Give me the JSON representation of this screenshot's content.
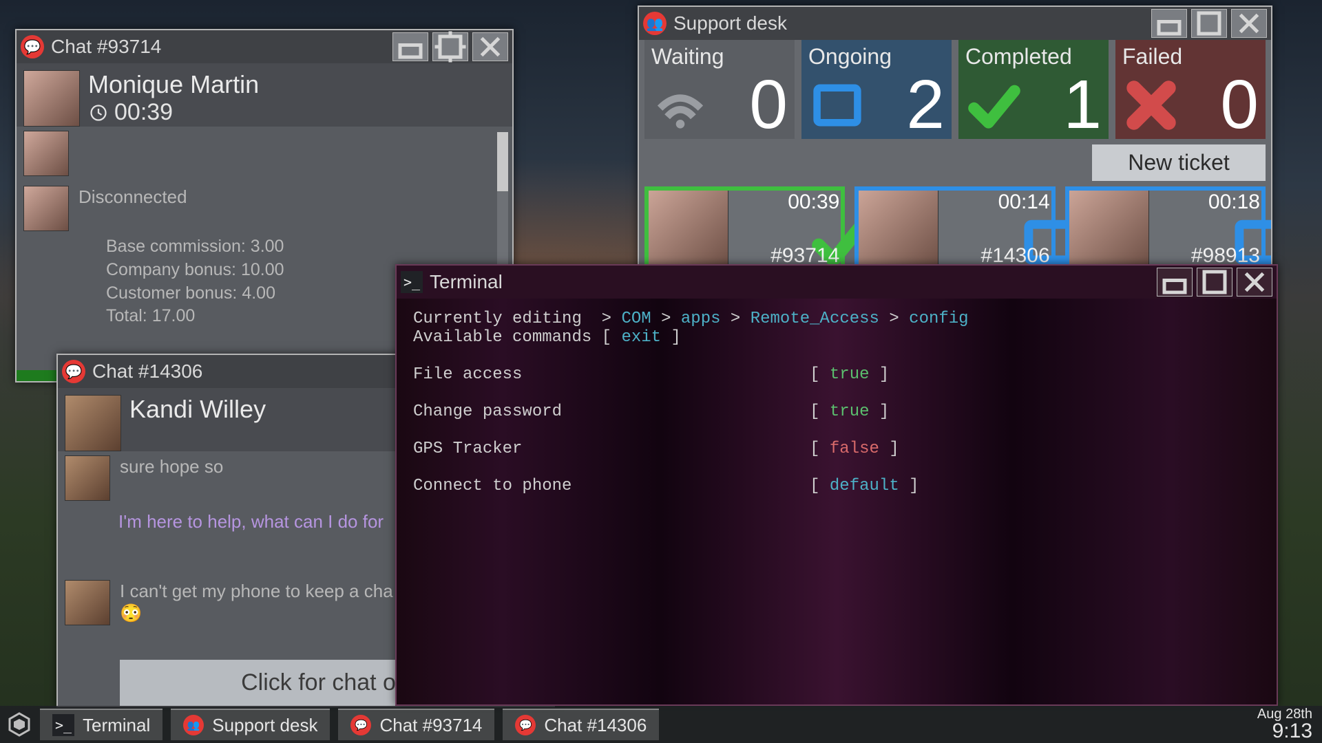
{
  "taskbar": {
    "items": [
      {
        "label": "Terminal",
        "icon": "terminal"
      },
      {
        "label": "Support desk",
        "icon": "support"
      },
      {
        "label": "Chat #93714",
        "icon": "chat"
      },
      {
        "label": "Chat #14306",
        "icon": "chat"
      }
    ],
    "date": "Aug 28th",
    "time": "9:13"
  },
  "chat1": {
    "title": "Chat #93714",
    "name": "Monique Martin",
    "timer": "00:39",
    "disconnected": "Disconnected",
    "commission": {
      "base": "Base commission: 3.00",
      "company": "Company bonus: 10.00",
      "customer": "Customer bonus: 4.00",
      "total": "Total: 17.00"
    }
  },
  "chat2": {
    "title": "Chat #14306",
    "name": "Kandi Willey",
    "lines": {
      "l1": "sure hope so",
      "l2": "I'm here to help, what can I do for",
      "l3": "I can't get my phone to keep a cha",
      "emoji": "😳"
    },
    "options": "Click for chat optic"
  },
  "support": {
    "title": "Support desk",
    "stats": {
      "waiting": {
        "label": "Waiting",
        "value": "0"
      },
      "ongoing": {
        "label": "Ongoing",
        "value": "2"
      },
      "completed": {
        "label": "Completed",
        "value": "1"
      },
      "failed": {
        "label": "Failed",
        "value": "0"
      }
    },
    "newticket": "New ticket",
    "tickets": [
      {
        "id": "#93714",
        "timer": "00:39",
        "status": "completed"
      },
      {
        "id": "#14306",
        "timer": "00:14",
        "status": "ongoing"
      },
      {
        "id": "#98913",
        "timer": "00:18",
        "status": "ongoing"
      }
    ]
  },
  "terminal": {
    "title": "Terminal",
    "path": [
      "COM",
      "apps",
      "Remote_Access",
      "config"
    ],
    "path_prefix": "Currently editing  > ",
    "commands_label": "Available commands [ ",
    "commands_value": "exit",
    "commands_suffix": " ]",
    "rows": [
      {
        "label": "File access",
        "value": "true",
        "cls": "kw-true"
      },
      {
        "label": "Change password",
        "value": "true",
        "cls": "kw-true"
      },
      {
        "label": "GPS Tracker",
        "value": "false",
        "cls": "kw-false"
      },
      {
        "label": "Connect to phone",
        "value": "default",
        "cls": "kw-default"
      }
    ]
  }
}
